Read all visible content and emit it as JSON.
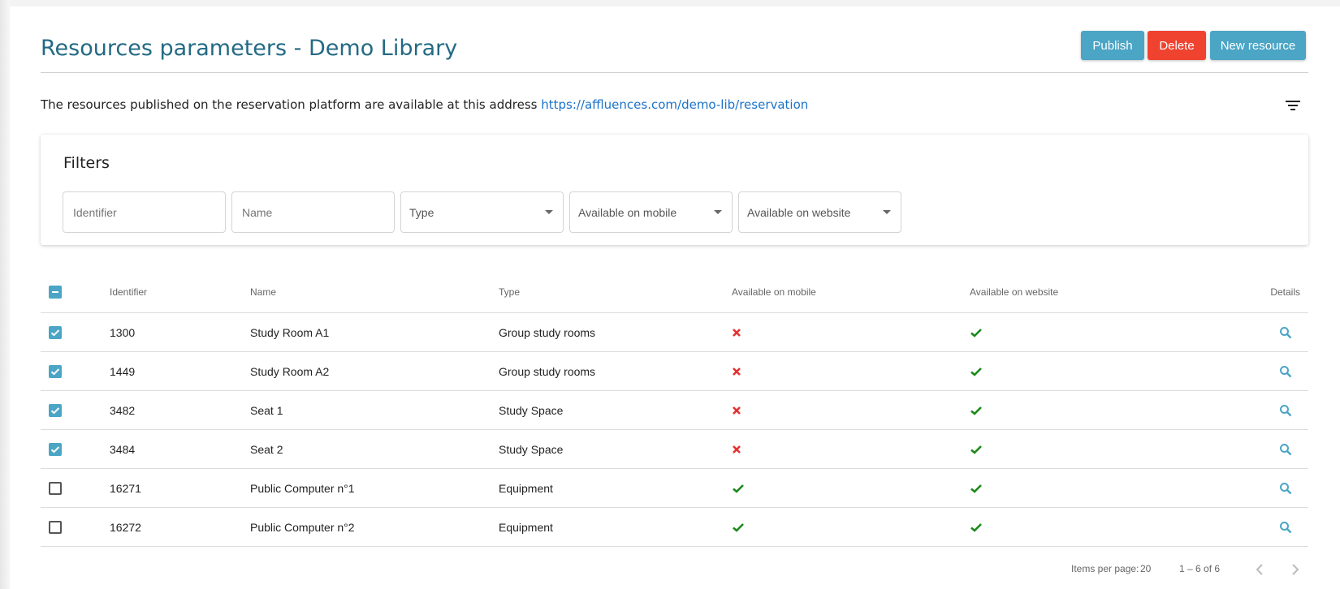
{
  "header": {
    "title": "Resources parameters - Demo Library",
    "buttons": {
      "publish": "Publish",
      "delete": "Delete",
      "new_resource": "New resource"
    }
  },
  "info": {
    "text": "The resources published on the reservation platform are available at this address ",
    "link": "https://affluences.com/demo-lib/reservation"
  },
  "filters": {
    "title": "Filters",
    "identifier_placeholder": "Identifier",
    "name_placeholder": "Name",
    "type_label": "Type",
    "mobile_label": "Available on mobile",
    "website_label": "Available on website"
  },
  "table": {
    "columns": {
      "identifier": "Identifier",
      "name": "Name",
      "type": "Type",
      "mobile": "Available on mobile",
      "website": "Available on website",
      "details": "Details"
    },
    "rows": [
      {
        "checked": true,
        "id": "1300",
        "name": "Study Room A1",
        "type": "Group study rooms",
        "mobile": false,
        "website": true
      },
      {
        "checked": true,
        "id": "1449",
        "name": "Study Room A2",
        "type": "Group study rooms",
        "mobile": false,
        "website": true
      },
      {
        "checked": true,
        "id": "3482",
        "name": "Seat 1",
        "type": "Study Space",
        "mobile": false,
        "website": true
      },
      {
        "checked": true,
        "id": "3484",
        "name": "Seat 2",
        "type": "Study Space",
        "mobile": false,
        "website": true
      },
      {
        "checked": false,
        "id": "16271",
        "name": "Public Computer n°1",
        "type": "Equipment",
        "mobile": true,
        "website": true
      },
      {
        "checked": false,
        "id": "16272",
        "name": "Public Computer n°2",
        "type": "Equipment",
        "mobile": true,
        "website": true
      }
    ]
  },
  "paginator": {
    "items_per_page_label": "Items per page:",
    "page_size": "20",
    "range": "1 – 6 of 6"
  },
  "colors": {
    "title": "#236a84",
    "primary": "#4ba5c5",
    "danger": "#f0432f",
    "link": "#1a73c9",
    "check_green": "#1a8a1a",
    "cross_red": "#e53030"
  },
  "icons": {
    "filter": "filter-list-icon",
    "details": "search-icon",
    "yes": "check-icon",
    "no": "close-icon"
  }
}
